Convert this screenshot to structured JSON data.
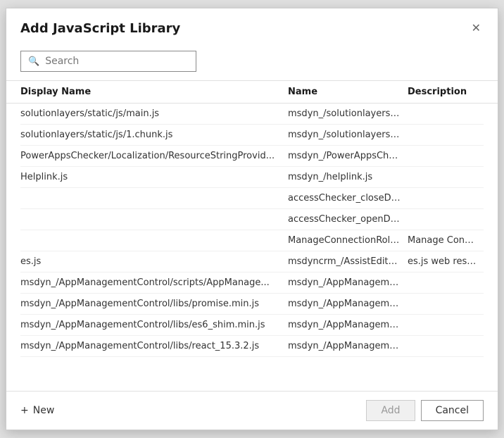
{
  "dialog": {
    "title": "Add JavaScript Library",
    "close_icon": "✕"
  },
  "search": {
    "placeholder": "Search",
    "icon": "🔍"
  },
  "table": {
    "headers": [
      "Display Name",
      "Name",
      "Description"
    ],
    "rows": [
      {
        "display_name": "solutionlayers/static/js/main.js",
        "name": "msdyn_/solutionlayers/sta...",
        "description": ""
      },
      {
        "display_name": "solutionlayers/static/js/1.chunk.js",
        "name": "msdyn_/solutionlayers/sta...",
        "description": ""
      },
      {
        "display_name": "PowerAppsChecker/Localization/ResourceStringProvid...",
        "name": "msdyn_/PowerAppsCheck...",
        "description": ""
      },
      {
        "display_name": "Helplink.js",
        "name": "msdyn_/helplink.js",
        "description": ""
      },
      {
        "display_name": "",
        "name": "accessChecker_closeDialo...",
        "description": ""
      },
      {
        "display_name": "",
        "name": "accessChecker_openDialo...",
        "description": ""
      },
      {
        "display_name": "",
        "name": "ManageConnectionRoles...",
        "description": "Manage Connect..."
      },
      {
        "display_name": "es.js",
        "name": "msdyncrm_/AssistEditCon...",
        "description": "es.js web resource."
      },
      {
        "display_name": "msdyn_/AppManagementControl/scripts/AppManage...",
        "name": "msdyn_/AppManagement...",
        "description": ""
      },
      {
        "display_name": "msdyn_/AppManagementControl/libs/promise.min.js",
        "name": "msdyn_/AppManagement...",
        "description": ""
      },
      {
        "display_name": "msdyn_/AppManagementControl/libs/es6_shim.min.js",
        "name": "msdyn_/AppManagement...",
        "description": ""
      },
      {
        "display_name": "msdyn_/AppManagementControl/libs/react_15.3.2.js",
        "name": "msdyn_/AppManagement...",
        "description": ""
      }
    ]
  },
  "footer": {
    "new_label": "New",
    "add_label": "Add",
    "cancel_label": "Cancel"
  }
}
